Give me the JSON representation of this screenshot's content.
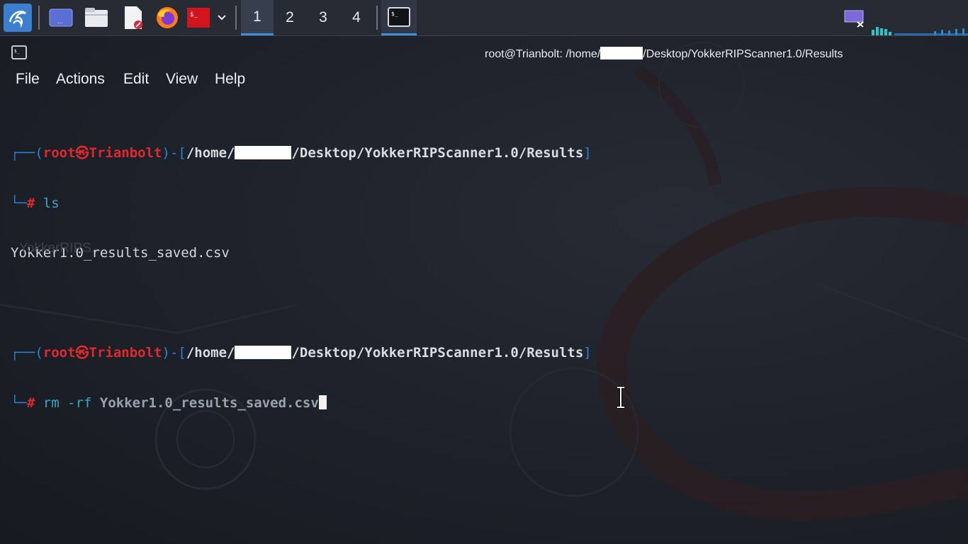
{
  "taskbar": {
    "workspaces": [
      "1",
      "2",
      "3",
      "4"
    ],
    "active_workspace": "1",
    "icons": [
      "kali-menu-icon",
      "show-desktop-icon",
      "file-manager-icon",
      "text-editor-icon",
      "firefox-icon",
      "terminal-icon",
      "chevron-down-icon",
      "terminal-task-icon",
      "network-icon",
      "cpu-graph-icon"
    ]
  },
  "window": {
    "title_prefix": "root@Trianbolt: /home/",
    "title_suffix": "/Desktop/YokkerRIPScanner1.0/Results"
  },
  "menu": {
    "file": "File",
    "actions": "Actions",
    "edit": "Edit",
    "view": "View",
    "help": "Help"
  },
  "terminal": {
    "prompt_user": "root",
    "prompt_at": "㉿",
    "prompt_host": "Trianbolt",
    "prompt_path_prefix": "/home/",
    "prompt_path_suffix": "/Desktop/YokkerRIPScanner1.0/Results",
    "prompt_hash": "#",
    "cmd1": "ls",
    "output1": "Yokker1.0_results_saved.csv",
    "cmd2_name": "rm",
    "cmd2_flag": "-rf",
    "cmd2_arg": "Yokker1.0_results_saved.csv"
  },
  "ghost_text": "YokkerRIPS...",
  "colors": {
    "prompt_frame": "#2f7fd6",
    "prompt_user": "#e0282e",
    "command": "#3aa7c2",
    "accent": "#3e8ed8"
  }
}
